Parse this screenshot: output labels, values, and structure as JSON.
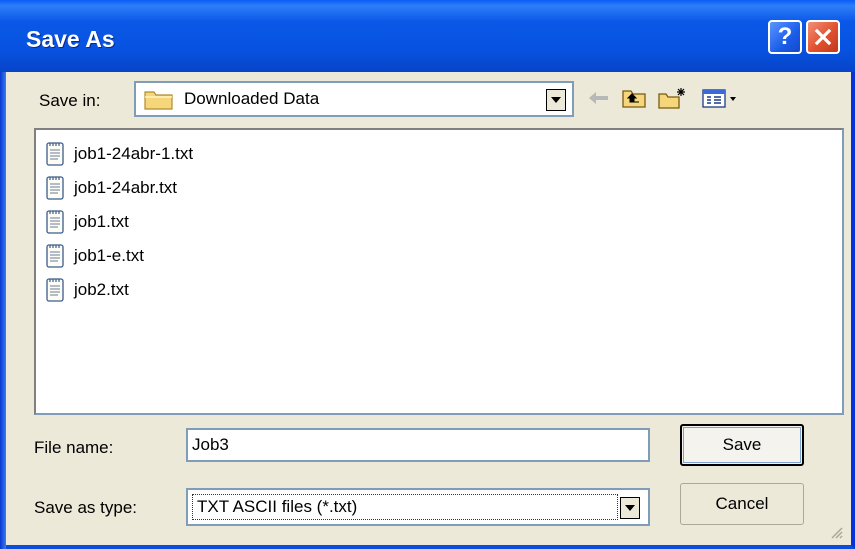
{
  "window": {
    "title": "Save As",
    "help_label": "?"
  },
  "save_in": {
    "label": "Save in:",
    "value": "Downloaded Data"
  },
  "files": [
    {
      "name": "job1-24abr-1.txt"
    },
    {
      "name": "job1-24abr.txt"
    },
    {
      "name": "job1.txt"
    },
    {
      "name": "job1-e.txt"
    },
    {
      "name": "job2.txt"
    }
  ],
  "form": {
    "file_name_label": "File name:",
    "file_name_value": "Job3",
    "save_as_type_label": "Save as type:",
    "save_as_type_value": "TXT ASCII files (*.txt)"
  },
  "buttons": {
    "save": "Save",
    "cancel": "Cancel"
  },
  "icons": {
    "back": "back-arrow-icon",
    "up": "up-one-level-icon",
    "new_folder": "new-folder-icon",
    "views": "views-menu-icon",
    "folder": "folder-icon",
    "file": "text-file-icon"
  }
}
